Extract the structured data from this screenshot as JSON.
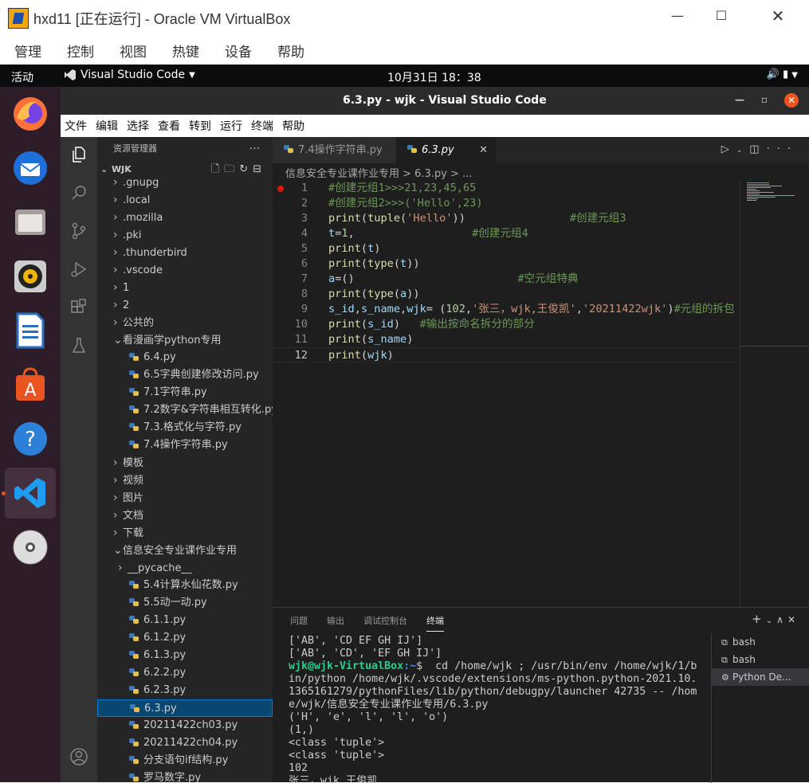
{
  "vbox": {
    "title": "hxd11 [正在运行] - Oracle VM VirtualBox",
    "menu": [
      "管理",
      "控制",
      "视图",
      "热键",
      "设备",
      "帮助"
    ]
  },
  "gnome": {
    "activities": "活动",
    "app_menu": "Visual Studio Code",
    "clock": "10月31日  18：38"
  },
  "vscode": {
    "title": "6.3.py - wjk - Visual Studio Code",
    "menu": [
      "文件",
      "编辑",
      "选择",
      "查看",
      "转到",
      "运行",
      "终端",
      "帮助"
    ],
    "explorer": {
      "header": "资源管理器",
      "folder": "WJK",
      "items": [
        {
          "label": ".gnupg",
          "type": "folder"
        },
        {
          "label": ".local",
          "type": "folder"
        },
        {
          "label": ".mozilla",
          "type": "folder"
        },
        {
          "label": ".pki",
          "type": "folder"
        },
        {
          "label": ".thunderbird",
          "type": "folder"
        },
        {
          "label": ".vscode",
          "type": "folder"
        },
        {
          "label": "1",
          "type": "folder"
        },
        {
          "label": "2",
          "type": "folder"
        },
        {
          "label": "公共的",
          "type": "folder"
        },
        {
          "label": "看漫画学python专用",
          "type": "open-folder"
        },
        {
          "label": "6.4.py",
          "type": "file"
        },
        {
          "label": "6.5字典创建修改访问.py",
          "type": "file"
        },
        {
          "label": "7.1字符串.py",
          "type": "file"
        },
        {
          "label": "7.2数字&字符串相互转化.py",
          "type": "file"
        },
        {
          "label": "7.3.格式化与字符.py",
          "type": "file"
        },
        {
          "label": "7.4操作字符串.py",
          "type": "file"
        },
        {
          "label": "模板",
          "type": "folder"
        },
        {
          "label": "视频",
          "type": "folder"
        },
        {
          "label": "图片",
          "type": "folder"
        },
        {
          "label": "文档",
          "type": "folder"
        },
        {
          "label": "下载",
          "type": "folder"
        },
        {
          "label": "信息安全专业课作业专用",
          "type": "open-folder"
        },
        {
          "label": "__pycache__",
          "type": "subfolder"
        },
        {
          "label": "5.4计算水仙花数.py",
          "type": "file"
        },
        {
          "label": "5.5动一动.py",
          "type": "file"
        },
        {
          "label": "6.1.1.py",
          "type": "file"
        },
        {
          "label": "6.1.2.py",
          "type": "file"
        },
        {
          "label": "6.1.3.py",
          "type": "file"
        },
        {
          "label": "6.2.2.py",
          "type": "file"
        },
        {
          "label": "6.2.3.py",
          "type": "file"
        },
        {
          "label": "6.3.py",
          "type": "file",
          "selected": true
        },
        {
          "label": "20211422ch03.py",
          "type": "file"
        },
        {
          "label": "20211422ch04.py",
          "type": "file"
        },
        {
          "label": "分支语句if结构.py",
          "type": "file"
        },
        {
          "label": "罗马数字.py",
          "type": "file"
        }
      ]
    },
    "tabs": [
      {
        "label": "7.4操作字符串.py",
        "active": false
      },
      {
        "label": "6.3.py",
        "active": true,
        "close": "✕"
      }
    ],
    "breadcrumb": "信息安全专业课作业专用 > 6.3.py > ...",
    "code_lines": [
      {
        "n": "1",
        "html": "<span class='c-cm'>#创建元组1&gt;&gt;&gt;21,23,45,65</span>"
      },
      {
        "n": "2",
        "html": "<span class='c-cm'>#创建元组2&gt;&gt;&gt;('Hello',23)</span>"
      },
      {
        "n": "3",
        "html": "<span class='c-fn'>print</span><span class='c-df'>(</span><span class='c-fn'>tuple</span><span class='c-df'>(</span><span class='c-st'>'Hello'</span><span class='c-df'>))</span>                <span class='c-cm'>#创建元组3</span>"
      },
      {
        "n": "4",
        "html": "<span class='c-vr'>t</span><span class='c-df'>=</span><span class='c-nm'>1</span><span class='c-df'>,</span>                  <span class='c-cm'>#创建元组4</span>"
      },
      {
        "n": "5",
        "html": "<span class='c-fn'>print</span><span class='c-df'>(</span><span class='c-vr'>t</span><span class='c-df'>)</span>"
      },
      {
        "n": "6",
        "html": "<span class='c-fn'>print</span><span class='c-df'>(</span><span class='c-fn'>type</span><span class='c-df'>(</span><span class='c-vr'>t</span><span class='c-df'>))</span>"
      },
      {
        "n": "7",
        "html": "<span class='c-vr'>a</span><span class='c-df'>=()</span>                         <span class='c-cm'>#空元组特典</span>"
      },
      {
        "n": "8",
        "html": "<span class='c-fn'>print</span><span class='c-df'>(</span><span class='c-fn'>type</span><span class='c-df'>(</span><span class='c-vr'>a</span><span class='c-df'>))</span>"
      },
      {
        "n": "9",
        "html": "<span class='c-vr'>s_id</span><span class='c-df'>,</span><span class='c-vr'>s_name</span><span class='c-df'>,</span><span class='c-vr'>wjk</span><span class='c-df'>= (</span><span class='c-nm'>102</span><span class='c-df'>,</span><span class='c-st'>'张三，wjk,王俊凯'</span><span class='c-df'>,</span><span class='c-st'>'20211422wjk'</span><span class='c-df'>)</span><span class='c-cm'>#元组的拆包</span>"
      },
      {
        "n": "10",
        "html": "<span class='c-fn'>print</span><span class='c-df'>(</span><span class='c-vr'>s_id</span><span class='c-df'>)</span>   <span class='c-cm'>#输出按命名拆分的部分</span>"
      },
      {
        "n": "11",
        "html": "<span class='c-fn'>print</span><span class='c-df'>(</span><span class='c-vr'>s_name</span><span class='c-df'>)</span>"
      },
      {
        "n": "12",
        "html": "<span class='c-fn'>print</span><span class='c-df'>(</span><span class='c-vr'>wjk</span><span class='c-df'>)</span>"
      }
    ],
    "panel": {
      "tabs": [
        "问题",
        "输出",
        "调试控制台",
        "终端"
      ],
      "active_tab": "终端",
      "terminal_lines_before": [
        "['AB', 'CD EF GH IJ']",
        "['AB', 'CD', 'EF GH IJ']"
      ],
      "prompt_user": "wjk@wjk-VirtualBox",
      "prompt_path": ":~",
      "command": "$  cd /home/wjk ; /usr/bin/env /home/wjk/1/bin/python /home/wjk/.vscode/extensions/ms-python.python-2021.10.1365161279/pythonFiles/lib/python/debugpy/launcher 42735 -- /home/wjk/信息安全专业课作业专用/6.3.py",
      "terminal_lines_after": [
        "('H', 'e', 'l', 'l', 'o')",
        "(1,)",
        "<class 'tuple'>",
        "<class 'tuple'>",
        "102",
        "张三，wjk,王俊凯"
      ],
      "terminals": [
        {
          "label": "bash",
          "icon": "terminal-icon"
        },
        {
          "label": "bash",
          "icon": "terminal-icon"
        },
        {
          "label": "Python De...",
          "icon": "debug-gear-icon",
          "selected": true
        }
      ]
    }
  },
  "colors": {
    "accent": "#007acc",
    "ubuntu_orange": "#e95420",
    "dock_bg": "#2c1d29"
  }
}
